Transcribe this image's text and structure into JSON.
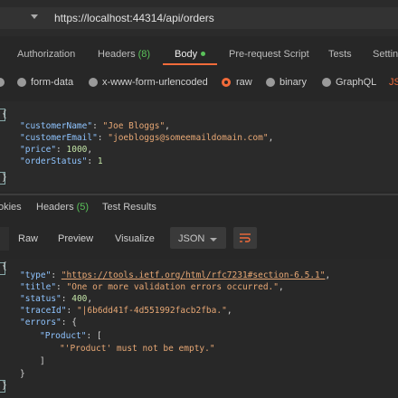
{
  "url_bar": {
    "url": "https://localhost:44314/api/orders"
  },
  "request_tabs": [
    {
      "label": "Authorization"
    },
    {
      "label": "Headers",
      "count": "(8)"
    },
    {
      "label": "Body"
    },
    {
      "label": "Pre-request Script"
    },
    {
      "label": "Tests"
    },
    {
      "label": "Settin"
    }
  ],
  "body_types": [
    {
      "label": "form-data"
    },
    {
      "label": "x-www-form-urlencoded"
    },
    {
      "label": "raw"
    },
    {
      "label": "binary"
    },
    {
      "label": "GraphQL"
    },
    {
      "label": "JS"
    }
  ],
  "request_body": {
    "lines": [
      "{",
      "  \"customerName\": \"Joe Bloggs\",",
      "  \"customerEmail\": \"joebloggs@someemaildomain.com\",",
      "  \"price\": 1000,",
      "  \"orderStatus\": 1",
      "}"
    ],
    "customerName_key": "\"customerName\"",
    "customerName_val": "\"Joe Bloggs\"",
    "customerEmail_key": "\"customerEmail\"",
    "customerEmail_val": "\"joebloggs@someemaildomain.com\"",
    "price_key": "\"price\"",
    "price_val": "1000",
    "orderStatus_key": "\"orderStatus\"",
    "orderStatus_val": "1"
  },
  "response_tabs": [
    {
      "label": "okies"
    },
    {
      "label": "Headers",
      "count": "(5)"
    },
    {
      "label": "Test Results"
    }
  ],
  "response_toolbar": {
    "raw": "Raw",
    "preview": "Preview",
    "visualize": "Visualize",
    "format": "JSON"
  },
  "response_body": {
    "type_key": "\"type\"",
    "type_val": "\"https://tools.ietf.org/html/rfc7231#section-6.5.1\"",
    "title_key": "\"title\"",
    "title_val": "\"One or more validation errors occurred.\"",
    "status_key": "\"status\"",
    "status_val": "400",
    "traceId_key": "\"traceId\"",
    "traceId_val": "\"|6b6dd41f-4d551992facb2fba.\"",
    "errors_key": "\"errors\"",
    "product_key": "\"Product\"",
    "product_msg": "\"'Product' must not be empty.\""
  },
  "colors": {
    "accent": "#f26b3a",
    "active_dot": "#5ac25a",
    "json_key": "#8fc4ff",
    "json_string": "#e8a875",
    "json_number": "#c4e6a8"
  }
}
